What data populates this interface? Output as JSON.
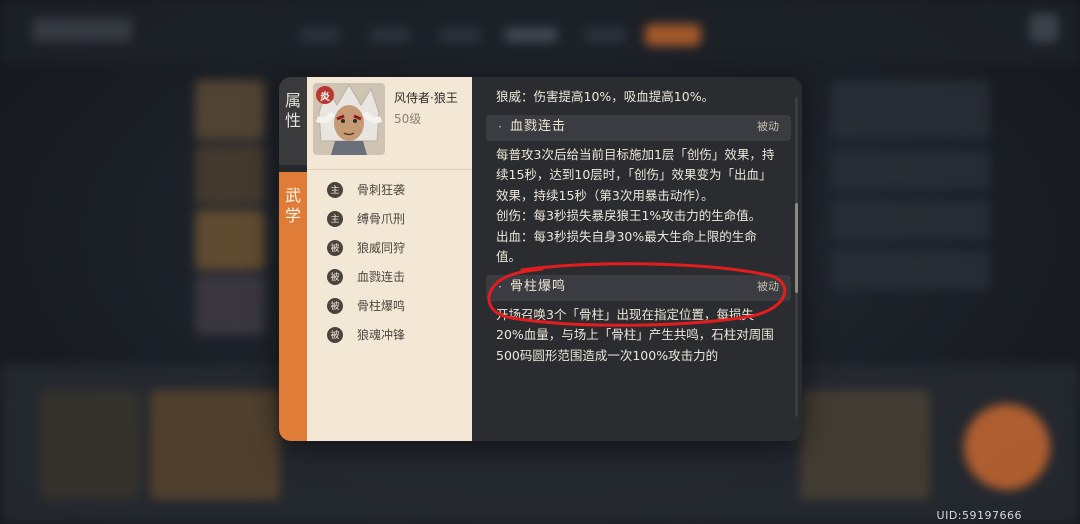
{
  "uid": "UID:59197666",
  "colors": {
    "accent_orange": "#df7c37",
    "panel_dark": "#2b2c30",
    "panel_light": "#f3e8d6",
    "annotation_red": "#e11d1d"
  },
  "side_tabs": {
    "attributes": [
      "属",
      "性"
    ],
    "martial": [
      "武",
      "学"
    ]
  },
  "character": {
    "element_badge": "炎",
    "name": "风侍者·狼王",
    "level": "50级"
  },
  "skills": [
    {
      "type": "主",
      "name": "骨刺狂袭"
    },
    {
      "type": "主",
      "name": "缚骨爪刑"
    },
    {
      "type": "被",
      "name": "狼威同狩"
    },
    {
      "type": "被",
      "name": "血戮连击"
    },
    {
      "type": "被",
      "name": "骨柱爆鸣"
    },
    {
      "type": "被",
      "name": "狼魂冲锋"
    }
  ],
  "detail": {
    "intro": "狼威：伤害提高10%，吸血提高10%。",
    "sections": [
      {
        "title": "血戮连击",
        "tag": "被动",
        "lines": [
          "每普攻3次后给当前目标施加1层「创伤」效果，持续15秒，达到10层时，「创伤」效果变为「出血」效果，持续15秒（第3次用暴击动作）。",
          "创伤：每3秒损失暴戾狼王1%攻击力的生命值。",
          "出血：每3秒损失自身30%最大生命上限的生命值。"
        ]
      },
      {
        "title": "骨柱爆鸣",
        "tag": "被动",
        "lines": [
          "开场召唤3个「骨柱」出现在指定位置，每损失20%血量，与场上「骨柱」产生共鸣，石柱对周围500码圆形范围造成一次100%攻击力的"
        ]
      }
    ]
  }
}
